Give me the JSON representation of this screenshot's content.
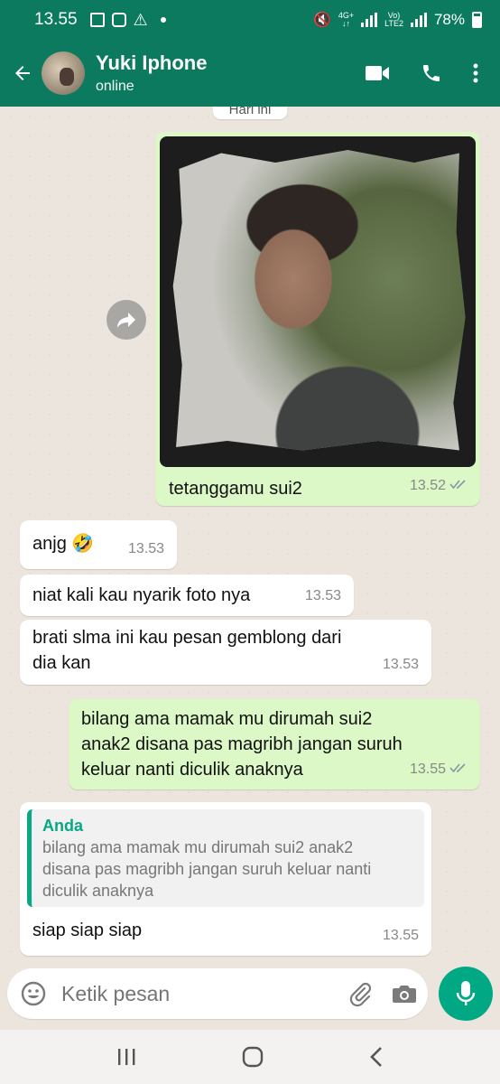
{
  "status_bar": {
    "time": "13.55",
    "network_top": "4G+",
    "volte_top": "Vo)",
    "volte_bottom": "LTE2",
    "battery": "78%"
  },
  "header": {
    "contact_name": "Yuki Iphone",
    "presence": "online"
  },
  "date_chip": "Hari ini",
  "messages": [
    {
      "direction": "out",
      "type": "image",
      "caption": "tetanggamu sui2",
      "time": "13.52",
      "read": true
    },
    {
      "direction": "in",
      "text": "anjg",
      "emoji": "🤣",
      "time": "13.53"
    },
    {
      "direction": "in",
      "text": "niat kali kau nyarik foto nya",
      "time": "13.53"
    },
    {
      "direction": "in",
      "text_lines": [
        "brati slma ini kau pesan gemblong dari",
        "dia kan"
      ],
      "time": "13.53"
    },
    {
      "direction": "out",
      "text_lines": [
        "bilang ama mamak mu dirumah sui2",
        "anak2 disana pas magribh jangan suruh",
        "keluar nanti diculik anaknya"
      ],
      "time": "13.55",
      "read": true
    },
    {
      "direction": "in",
      "reply_to": {
        "author": "Anda",
        "lines": [
          "bilang ama mamak mu dirumah sui2 anak2",
          "disana pas magribh jangan suruh keluar nanti",
          "diculik anaknya"
        ]
      },
      "text": "siap siap siap",
      "time": "13.55"
    }
  ],
  "composer": {
    "placeholder": "Ketik pesan"
  },
  "colors": {
    "header": "#0b7a5f",
    "outgoing_bubble": "#dcf8c6",
    "incoming_bubble": "#ffffff",
    "accent": "#00a884",
    "read_tick": "#8696a0"
  },
  "icons": [
    "back-arrow-icon",
    "video-call-icon",
    "phone-icon",
    "more-vert-icon",
    "forward-icon",
    "emoji-icon",
    "attach-icon",
    "camera-icon",
    "mic-icon",
    "recents-icon",
    "home-icon",
    "nav-back-icon"
  ]
}
